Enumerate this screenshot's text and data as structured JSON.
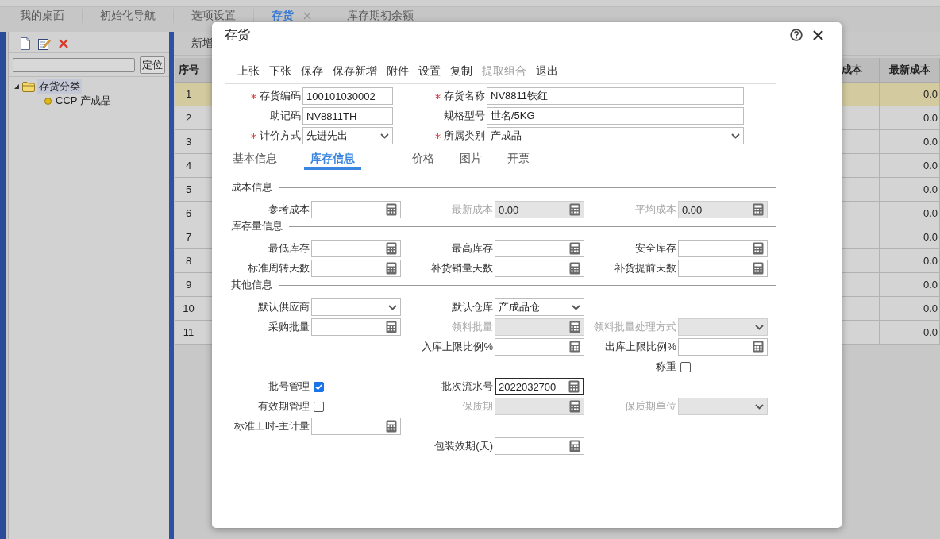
{
  "top_tabs": [
    {
      "label": "我的桌面",
      "selected": false,
      "closable": false
    },
    {
      "label": "初始化导航",
      "selected": false,
      "closable": false
    },
    {
      "label": "选项设置",
      "selected": false,
      "closable": false
    },
    {
      "label": "存货",
      "selected": true,
      "closable": true
    },
    {
      "label": "库存期初余额",
      "selected": false,
      "closable": false
    }
  ],
  "sidebar": {
    "locate_button": "定位",
    "tree": [
      {
        "label": "存货分类",
        "expanded": true,
        "selected": true,
        "children": [
          {
            "label": "CCP 产成品",
            "selected": false
          }
        ]
      }
    ]
  },
  "main": {
    "toolbar": [
      "新增"
    ],
    "table": {
      "columns": [
        {
          "label": "序号"
        },
        {
          "label": "成本"
        },
        {
          "label": "最新成本"
        }
      ],
      "rows": [
        {
          "index": "1",
          "latest_cost": "0.0",
          "selected": true
        },
        {
          "index": "2",
          "latest_cost": "0.0",
          "selected": false
        },
        {
          "index": "3",
          "latest_cost": "0.0",
          "selected": false
        },
        {
          "index": "4",
          "latest_cost": "0.0",
          "selected": false
        },
        {
          "index": "5",
          "latest_cost": "0.0",
          "selected": false
        },
        {
          "index": "6",
          "latest_cost": "0.0",
          "selected": false
        },
        {
          "index": "7",
          "latest_cost": "0.0",
          "selected": false
        },
        {
          "index": "8",
          "latest_cost": "0.0",
          "selected": false
        },
        {
          "index": "9",
          "latest_cost": "0.0",
          "selected": false
        },
        {
          "index": "10",
          "latest_cost": "0.0",
          "selected": false
        },
        {
          "index": "11",
          "latest_cost": "0.0",
          "selected": false
        }
      ]
    }
  },
  "dialog": {
    "title": "存货",
    "toolbar": [
      {
        "label": "上张",
        "disabled": false
      },
      {
        "label": "下张",
        "disabled": false
      },
      {
        "label": "保存",
        "disabled": false
      },
      {
        "label": "保存新增",
        "disabled": false
      },
      {
        "label": "附件",
        "disabled": false
      },
      {
        "label": "设置",
        "disabled": false
      },
      {
        "label": "复制",
        "disabled": false
      },
      {
        "label": "提取组合",
        "disabled": true
      },
      {
        "label": "退出",
        "disabled": false
      }
    ],
    "header_fields": [
      {
        "label": "存货编码",
        "required": true,
        "kind": "text",
        "value": "100101030002"
      },
      {
        "label": "存货名称",
        "required": true,
        "kind": "text",
        "value": "NV8811铁红"
      },
      {
        "label": "助记码",
        "required": false,
        "kind": "text",
        "value": "NV8811TH"
      },
      {
        "label": "规格型号",
        "required": false,
        "kind": "text",
        "value": "世名/5KG"
      },
      {
        "label": "计价方式",
        "required": true,
        "kind": "select",
        "value": "先进先出"
      },
      {
        "label": "所属类别",
        "required": true,
        "kind": "select",
        "value": "产成品"
      }
    ],
    "tabs": [
      {
        "label": "基本信息",
        "selected": false
      },
      {
        "label": "库存信息",
        "selected": true
      },
      {
        "label": "价格",
        "selected": false
      },
      {
        "label": "图片",
        "selected": false
      },
      {
        "label": "开票",
        "selected": false
      }
    ],
    "sections": [
      {
        "title": "成本信息",
        "rows": [
          [
            {
              "label": "参考成本",
              "kind": "number",
              "disabled": false
            },
            {
              "label": "最新成本",
              "kind": "number",
              "disabled": true,
              "value": "0.00"
            },
            {
              "label": "平均成本",
              "kind": "number",
              "disabled": true,
              "value": "0.00"
            }
          ]
        ]
      },
      {
        "title": "库存量信息",
        "rows": [
          [
            {
              "label": "最低库存",
              "kind": "number",
              "disabled": false
            },
            {
              "label": "最高库存",
              "kind": "number",
              "disabled": false
            },
            {
              "label": "安全库存",
              "kind": "number",
              "disabled": false
            }
          ],
          [
            {
              "label": "标准周转天数",
              "kind": "number",
              "disabled": false
            },
            {
              "label": "补货销量天数",
              "kind": "number",
              "disabled": false
            },
            {
              "label": "补货提前天数",
              "kind": "number",
              "disabled": false
            }
          ]
        ]
      },
      {
        "title": "其他信息",
        "rows": [
          [
            {
              "label": "默认供应商",
              "kind": "select",
              "disabled": false
            },
            {
              "label": "默认仓库",
              "kind": "select",
              "disabled": false,
              "value": "产成品仓"
            },
            null
          ],
          [
            {
              "label": "采购批量",
              "kind": "number",
              "disabled": false
            },
            {
              "label": "领料批量",
              "kind": "number",
              "disabled": true
            },
            {
              "label": "领料批量处理方式",
              "kind": "select",
              "disabled": true
            }
          ],
          [
            null,
            {
              "label": "入库上限比例%",
              "kind": "number",
              "disabled": false
            },
            {
              "label": "出库上限比例%",
              "kind": "number",
              "disabled": false
            }
          ],
          [
            null,
            null,
            {
              "label": "称重",
              "kind": "checkbox",
              "checked": false
            }
          ],
          [
            {
              "label": "批号管理",
              "kind": "checkbox",
              "checked": true
            },
            {
              "label": "批次流水号",
              "kind": "number",
              "disabled": false,
              "value": "2022032700",
              "focused": true
            },
            null
          ],
          [
            {
              "label": "有效期管理",
              "kind": "checkbox",
              "checked": false
            },
            {
              "label": "保质期",
              "kind": "number",
              "disabled": true
            },
            {
              "label": "保质期单位",
              "kind": "select",
              "disabled": true
            }
          ],
          [
            {
              "label": "标准工时-主计量",
              "kind": "number",
              "disabled": false
            },
            null,
            null
          ],
          [
            null,
            {
              "label": "包装效期(天)",
              "kind": "number",
              "disabled": false
            },
            null
          ]
        ]
      }
    ]
  }
}
